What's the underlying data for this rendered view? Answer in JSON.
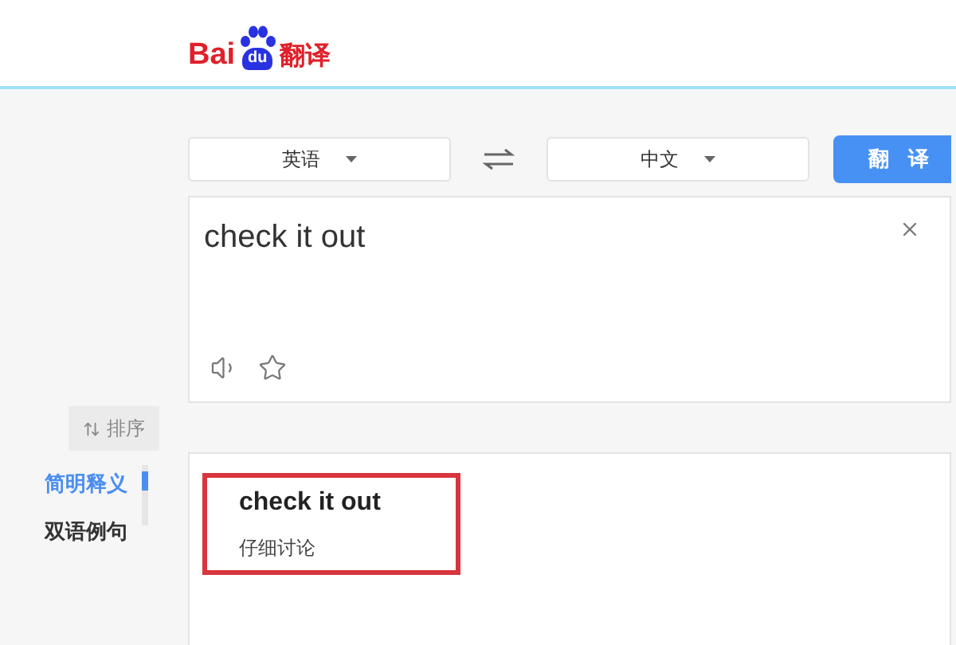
{
  "logo": {
    "prefix": "Bai",
    "badge": "du",
    "suffix": "翻译"
  },
  "languages": {
    "source": "英语",
    "target": "中文"
  },
  "translate_button": "翻译",
  "input": {
    "value": "check it out"
  },
  "sort_button": "排序",
  "sidebar": {
    "items": [
      {
        "label": "简明释义",
        "selected": true
      },
      {
        "label": "双语例句",
        "selected": false
      }
    ]
  },
  "result": {
    "term": "check it out",
    "meaning": "仔细讨论",
    "highlighted": true
  }
}
